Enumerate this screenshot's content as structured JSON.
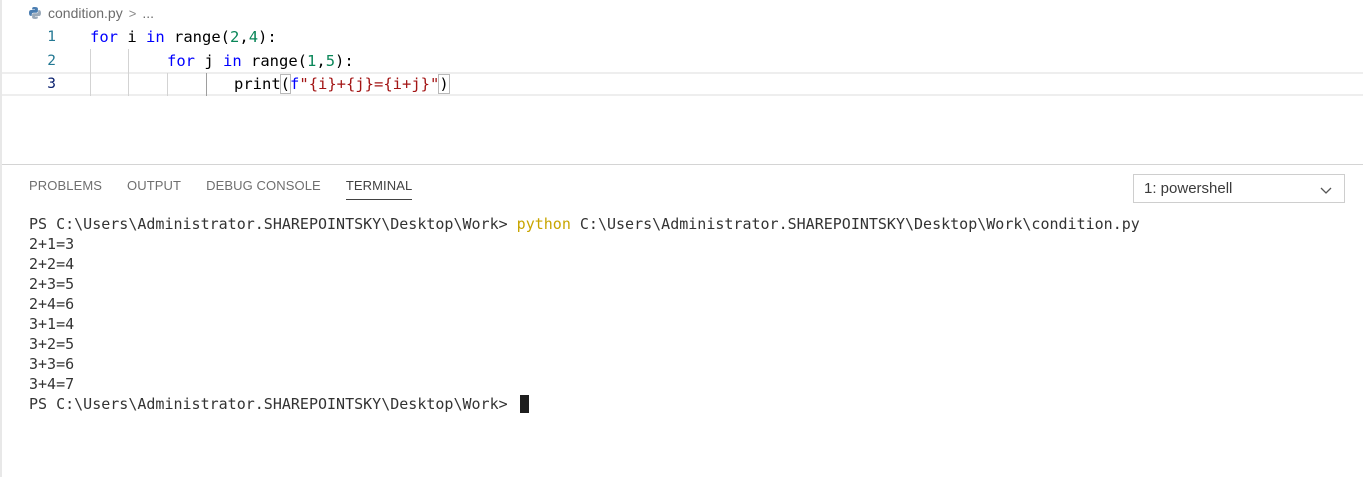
{
  "breadcrumb": {
    "file": "condition.py",
    "separator": ">",
    "more": "..."
  },
  "editor": {
    "lines": [
      {
        "number": "1"
      },
      {
        "number": "2"
      },
      {
        "number": "3"
      }
    ],
    "colors": {
      "keyword": "#0000ff",
      "number": "#098658",
      "string": "#a31515",
      "line_number": "#237893"
    }
  },
  "code": {
    "l1": {
      "for": "for",
      "var": " i ",
      "in": "in",
      "call": " range(",
      "a": "2",
      "comma": ",",
      "b": "4",
      "end": "):"
    },
    "l2": {
      "for": "for",
      "var": " j ",
      "in": "in",
      "call": " range(",
      "a": "1",
      "comma": ",",
      "b": "5",
      "end": "):"
    },
    "l3": {
      "fn": "print",
      "open": "(",
      "f": "f",
      "str": "\"{i}+{j}={i+j}\"",
      "close": ")"
    }
  },
  "panel": {
    "tabs": [
      {
        "label": "PROBLEMS"
      },
      {
        "label": "OUTPUT"
      },
      {
        "label": "DEBUG CONSOLE"
      },
      {
        "label": "TERMINAL"
      }
    ],
    "shell_select": "1: powershell"
  },
  "terminal": {
    "prompt": "PS C:\\Users\\Administrator.SHAREPOINTSKY\\Desktop\\Work> ",
    "command": "python",
    "command_arg": " C:\\Users\\Administrator.SHAREPOINTSKY\\Desktop\\Work\\condition.py",
    "output": [
      "2+1=3",
      "2+2=4",
      "2+3=5",
      "2+4=6",
      "3+1=4",
      "3+2=5",
      "3+3=6",
      "3+4=7"
    ],
    "final_prompt": "PS C:\\Users\\Administrator.SHAREPOINTSKY\\Desktop\\Work> "
  }
}
